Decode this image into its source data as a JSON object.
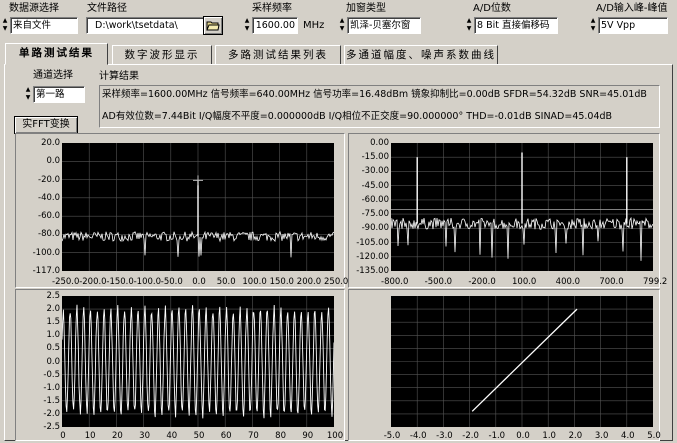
{
  "controls": {
    "source": {
      "label": "数据源选择",
      "value": "来自文件"
    },
    "path": {
      "label": "文件路径",
      "value": "D:\\work\\tsetdata\\"
    },
    "rate": {
      "label": "采样频率",
      "value": "1600.00",
      "unit": "MHz"
    },
    "window": {
      "label": "加窗类型",
      "value": "凯泽-贝塞尔窗"
    },
    "bits": {
      "label": "A/D位数",
      "value": "8 Bit 直接偏移码"
    },
    "vpp": {
      "label": "A/D输入峰-峰值",
      "value": "5V Vpp"
    }
  },
  "tabs": [
    "单路测试结果",
    "数字波形显示",
    "多路测试结果列表",
    "多通道幅度、噪声系数曲线"
  ],
  "channel": {
    "label": "通道选择",
    "value": "第一路"
  },
  "fft_button": "实FFT变换",
  "results": {
    "label": "计算结果",
    "line1": "采样频率=1600.00MHz 信号频率=640.00MHz 信号功率=16.48dBm 镜象抑制比=0.00dB SFDR=54.32dB SNR=45.01dB",
    "line2": "AD有效位数=7.44Bit I/Q幅度不平度=0.000000dB I/Q相位不正交度=90.000000° THD=-0.01dB SINAD=45.04dB"
  },
  "colors": {
    "plot_bg": "#000000",
    "trace": "#ffffff",
    "grid": "#555555",
    "panel": "#d4d0c8"
  },
  "chart_data": [
    {
      "type": "line",
      "name": "spectrum-left",
      "xticks": [
        "-250.0",
        "-200.0",
        "-150.0",
        "-100.0",
        "-50.0",
        "0.0",
        "50.0",
        "100.0",
        "150.0",
        "200.0",
        "250.0"
      ],
      "yticks": [
        "20.0",
        "0.0",
        "-20.0",
        "-40.0",
        "-60.0",
        "-80.0",
        "-100.0",
        "-117.0"
      ],
      "xlim": [
        -250,
        250
      ],
      "ylim": [
        -117,
        20
      ],
      "noise_floor": -80,
      "peaks": [
        {
          "x": 0,
          "y": -20
        }
      ],
      "grid": true
    },
    {
      "type": "line",
      "name": "spectrum-right",
      "xticks": [
        "-800.0",
        "-500.0",
        "-200.0",
        "100.0",
        "400.0",
        "700.0",
        "799.2"
      ],
      "yticks": [
        "0.00",
        "-15.00",
        "-30.00",
        "-45.00",
        "-60.00",
        "-75.00",
        "-90.00",
        "-105.00",
        "-120.00",
        "-135.00"
      ],
      "xlim": [
        -800,
        800
      ],
      "ylim": [
        -135,
        0
      ],
      "noise_floor": -85,
      "peaks": [
        {
          "x": -640,
          "y": -15
        },
        {
          "x": 0,
          "y": -10
        },
        {
          "x": 640,
          "y": -15
        }
      ],
      "hline": -70,
      "grid": true
    },
    {
      "type": "line",
      "name": "waveform",
      "xticks": [
        "0",
        "10",
        "20",
        "30",
        "40",
        "50",
        "60",
        "70",
        "80",
        "90",
        "100"
      ],
      "yticks": [
        "2.5",
        "2.0",
        "1.5",
        "1.0",
        "0.5",
        "0.0",
        "-0.5",
        "-1.0",
        "-1.5",
        "-2.0",
        "-2.5"
      ],
      "xlim": [
        0,
        100
      ],
      "ylim": [
        -2.5,
        2.5
      ],
      "amplitude": 2.0,
      "cycles": 40,
      "grid": true
    },
    {
      "type": "scatter",
      "name": "iq-plot",
      "xticks": [
        "-5.0",
        "-4.0",
        "-3.0",
        "-2.0",
        "-1.0",
        "0.0",
        "1.0",
        "2.0",
        "3.0",
        "4.0",
        "5.0"
      ],
      "yticks": [],
      "xlim": [
        -5,
        5
      ],
      "ylim": [
        -2.5,
        2.5
      ],
      "line": {
        "x": [
          -1.9,
          2.1
        ],
        "y": [
          -1.9,
          2.0
        ]
      },
      "grid": true
    }
  ]
}
